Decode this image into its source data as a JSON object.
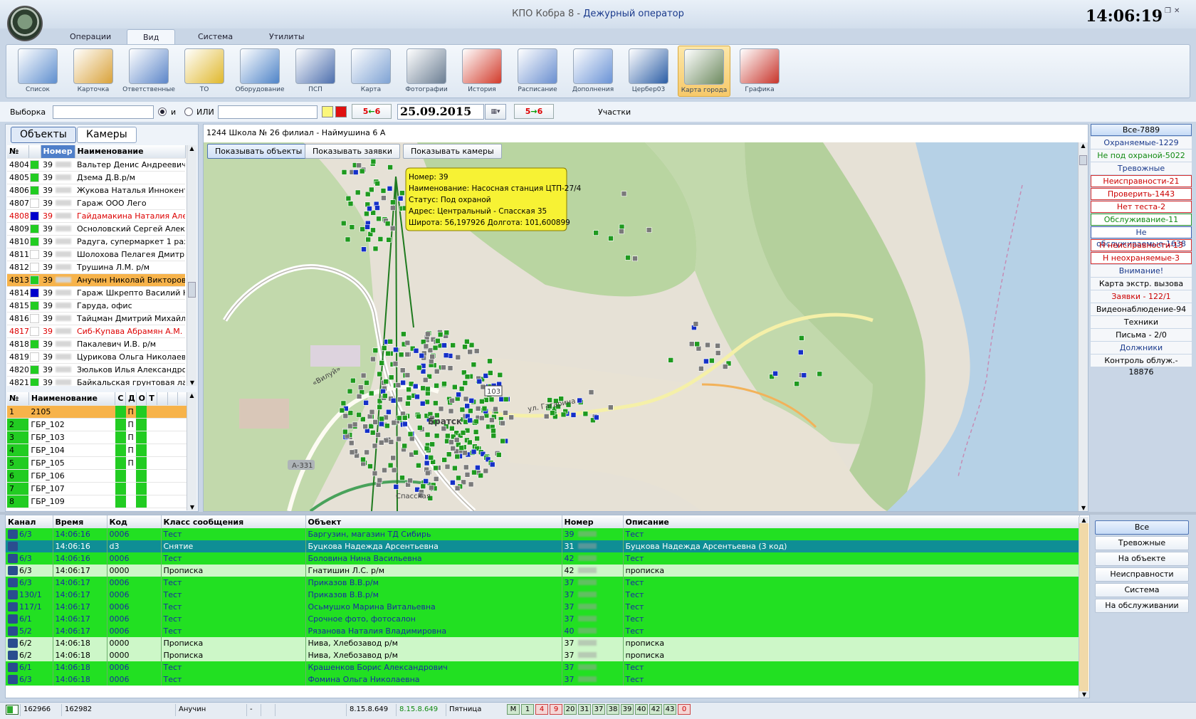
{
  "window": {
    "app_title": "КПО Кобра 8 - ",
    "role": "Дежурный оператор",
    "clock": "14:06:19"
  },
  "tabs": [
    "Операции",
    "Вид",
    "Система",
    "Утилиты"
  ],
  "ribbon": [
    {
      "label": "Список",
      "icon": "list-icon"
    },
    {
      "label": "Карточка",
      "icon": "card-icon"
    },
    {
      "label": "Ответственные",
      "icon": "users-icon"
    },
    {
      "label": "ТО",
      "icon": "maintenance-icon"
    },
    {
      "label": "Оборудование",
      "icon": "equipment-icon"
    },
    {
      "label": "ПСП",
      "icon": "psp-icon"
    },
    {
      "label": "Карта",
      "icon": "map-icon"
    },
    {
      "label": "Фотографии",
      "icon": "camera-icon"
    },
    {
      "label": "История",
      "icon": "history-icon"
    },
    {
      "label": "Расписание",
      "icon": "schedule-icon"
    },
    {
      "label": "Дополнения",
      "icon": "addons-icon"
    },
    {
      "label": "Цербер03",
      "icon": "cerber-icon"
    },
    {
      "label": "Карта города",
      "icon": "city-map-icon"
    },
    {
      "label": "Графика",
      "icon": "graphics-icon"
    }
  ],
  "filter": {
    "label": "Выборка",
    "and_label": "и",
    "or_label": "ИЛИ",
    "count_a": "5",
    "count_b": "6",
    "date": "25.09.2015",
    "areas_label": "Участки"
  },
  "left_tabs": {
    "objects": "Объекты",
    "cameras": "Камеры"
  },
  "objects_table": {
    "headers": [
      "№",
      "",
      "Номер",
      "Наименование"
    ],
    "rows": [
      {
        "n": "4804",
        "color": "#22cc22",
        "num": "39",
        "name": "Вальтер Денис Андреевич",
        "red": false,
        "sel": false
      },
      {
        "n": "4805",
        "color": "#22cc22",
        "num": "39",
        "name": "Дзема Д.В.р/м",
        "red": false,
        "sel": false
      },
      {
        "n": "4806",
        "color": "#22cc22",
        "num": "39",
        "name": "Жукова Наталья Иннокенть",
        "red": false,
        "sel": false
      },
      {
        "n": "4807",
        "color": "#ffffff",
        "num": "39",
        "name": "Гараж ООО Лего",
        "red": false,
        "sel": false
      },
      {
        "n": "4808",
        "color": "#0000cc",
        "num": "39",
        "name": "Гайдамакина Наталия Алек",
        "red": true,
        "sel": false
      },
      {
        "n": "4809",
        "color": "#22cc22",
        "num": "39",
        "name": "Осноловский Сергей Алекса",
        "red": false,
        "sel": false
      },
      {
        "n": "4810",
        "color": "#22cc22",
        "num": "39",
        "name": "Радуга, супермаркет 1 разд",
        "red": false,
        "sel": false
      },
      {
        "n": "4811",
        "color": "#ffffff",
        "num": "39",
        "name": "Шолохова Пелагея Дмитрие",
        "red": false,
        "sel": false
      },
      {
        "n": "4812",
        "color": "#ffffff",
        "num": "39",
        "name": "Трушина Л.М. р/м",
        "red": false,
        "sel": false
      },
      {
        "n": "4813",
        "color": "#22cc22",
        "num": "39",
        "name": "Анучин Николай Викторови",
        "red": false,
        "sel": true
      },
      {
        "n": "4814",
        "color": "#0000cc",
        "num": "39",
        "name": "Гараж Шкрепто Василий Ни",
        "red": false,
        "sel": false
      },
      {
        "n": "4815",
        "color": "#22cc22",
        "num": "39",
        "name": "Гаруда, офис",
        "red": false,
        "sel": false
      },
      {
        "n": "4816",
        "color": "#ffffff",
        "num": "39",
        "name": "Тайцман Дмитрий Михайлов",
        "red": false,
        "sel": false
      },
      {
        "n": "4817",
        "color": "#ffffff",
        "num": "39",
        "name": "Сиб-Купава Абрамян А.М. р",
        "red": true,
        "sel": false
      },
      {
        "n": "4818",
        "color": "#22cc22",
        "num": "39",
        "name": "Пакалевич И.В. р/м",
        "red": false,
        "sel": false
      },
      {
        "n": "4819",
        "color": "#ffffff",
        "num": "39",
        "name": "Цурикова Ольга Николаевн",
        "red": false,
        "sel": false
      },
      {
        "n": "4820",
        "color": "#22cc22",
        "num": "39",
        "name": "Зюльков Илья Александров",
        "red": false,
        "sel": false
      },
      {
        "n": "4821",
        "color": "#22cc22",
        "num": "39",
        "name": "Байкальская грунтовая лаб",
        "red": false,
        "sel": false
      }
    ]
  },
  "groups_table": {
    "headers": [
      "№",
      "Наименование",
      "С",
      "Д",
      "О",
      "Т"
    ],
    "rows": [
      {
        "n": "1",
        "name": "2105",
        "d": "П",
        "sel": true
      },
      {
        "n": "2",
        "name": "ГБР_102",
        "d": "П",
        "sel": false
      },
      {
        "n": "3",
        "name": "ГБР_103",
        "d": "П",
        "sel": false
      },
      {
        "n": "4",
        "name": "ГБР_104",
        "d": "П",
        "sel": false
      },
      {
        "n": "5",
        "name": "ГБР_105",
        "d": "П",
        "sel": false
      },
      {
        "n": "6",
        "name": "ГБР_106",
        "d": "",
        "sel": false
      },
      {
        "n": "7",
        "name": "ГБР_107",
        "d": "",
        "sel": false
      },
      {
        "n": "8",
        "name": "ГБР_109",
        "d": "",
        "sel": false
      }
    ]
  },
  "map": {
    "header": "1244 Школа № 26 филиал - Наймушина 6 А",
    "buttons": [
      "Показывать объекты",
      "Показывать заявки",
      "Показывать камеры"
    ],
    "tooltip": [
      "Номер: 39",
      "Наименование: Насосная станция ЦТП-27/4",
      "Статус: Под охраной",
      "Адрес: Центральный - Спасская 35",
      "Широта: 56,197926 Долгота: 101,600899"
    ],
    "labels": [
      "«Вилуй»",
      "А-331",
      "103",
      "ул. Гагарина",
      "Братск",
      "Спасская"
    ]
  },
  "categories": [
    {
      "label": "Все-7889",
      "color": "#000000",
      "style": "sel"
    },
    {
      "label": "Охраняемые-1229",
      "color": "#1a3a8c",
      "style": ""
    },
    {
      "label": "Не под охраной-5022",
      "color": "#118a11",
      "style": ""
    },
    {
      "label": "Тревожные",
      "color": "#1a3a8c",
      "style": ""
    },
    {
      "label": "Неисправности-21",
      "color": "#cc0000",
      "style": "red"
    },
    {
      "label": "Проверить-1443",
      "color": "#cc0000",
      "style": "red"
    },
    {
      "label": "Нет теста-2",
      "color": "#cc0000",
      "style": "red"
    },
    {
      "label": "Обслуживание-11",
      "color": "#118a11",
      "style": "green"
    },
    {
      "label": "Не обслуживаемые-1638",
      "color": "#1a3a8c",
      "style": "blue"
    },
    {
      "label": "Н неисправности-13",
      "color": "#cc0000",
      "style": "red"
    },
    {
      "label": "Н неохраняемые-3",
      "color": "#cc0000",
      "style": "red"
    },
    {
      "label": "Внимание!",
      "color": "#1a3a8c",
      "style": ""
    },
    {
      "label": "Карта экстр. вызова",
      "color": "#000000",
      "style": ""
    },
    {
      "label": "Заявки - 122/1",
      "color": "#cc0000",
      "style": ""
    },
    {
      "label": "Видеонаблюдение-94",
      "color": "#000000",
      "style": ""
    },
    {
      "label": "Техники",
      "color": "#000000",
      "style": ""
    },
    {
      "label": "Письма - 2/0",
      "color": "#000000",
      "style": ""
    },
    {
      "label": "Должники",
      "color": "#1a3a8c",
      "style": ""
    },
    {
      "label": "Контроль облуж.- 18876",
      "color": "#000000",
      "style": ""
    }
  ],
  "events": {
    "headers": [
      "Канал",
      "Время",
      "Код",
      "Класс сообщения",
      "Объект",
      "Номер",
      "Описание"
    ],
    "rows": [
      {
        "ch": "6/3",
        "time": "14:06:16",
        "code": "0006",
        "cls": "Тест",
        "obj": "Баргузин, магазин ТД Сибирь",
        "num": "39",
        "desc": "Тест",
        "style": "b",
        "chip": "C"
      },
      {
        "ch": "",
        "time": "14:06:16",
        "code": "d3",
        "cls": "Снятие",
        "obj": "Буцкова Надежда Арсентьевна",
        "num": "31",
        "desc": "Буцкова Надежда Арсентьевна (3 код)",
        "style": "t",
        "chip": "R"
      },
      {
        "ch": "6/3",
        "time": "14:06:16",
        "code": "0006",
        "cls": "Тест",
        "obj": "Боловина Нина Васильевна",
        "num": "42",
        "desc": "Тест",
        "style": "b",
        "chip": "C"
      },
      {
        "ch": "6/3",
        "time": "14:06:17",
        "code": "0000",
        "cls": "Прописка",
        "obj": "Гнатишин Л.С. р/м",
        "num": "42",
        "desc": "прописка",
        "style": "l",
        "chip": "C"
      },
      {
        "ch": "6/3",
        "time": "14:06:17",
        "code": "0006",
        "cls": "Тест",
        "obj": "Приказов В.В.р/м",
        "num": "37",
        "desc": "Тест",
        "style": "b",
        "chip": "C"
      },
      {
        "ch": "130/1",
        "time": "14:06:17",
        "code": "0006",
        "cls": "Тест",
        "obj": "Приказов В.В.р/м",
        "num": "37",
        "desc": "Тест",
        "style": "b",
        "chip": "C"
      },
      {
        "ch": "117/1",
        "time": "14:06:17",
        "code": "0006",
        "cls": "Тест",
        "obj": "Осьмушко Марина Витальевна",
        "num": "37",
        "desc": "Тест",
        "style": "b",
        "chip": "C"
      },
      {
        "ch": "6/1",
        "time": "14:06:17",
        "code": "0006",
        "cls": "Тест",
        "obj": "Срочное фото, фотосалон",
        "num": "37",
        "desc": "Тест",
        "style": "b",
        "chip": "C"
      },
      {
        "ch": "5/2",
        "time": "14:06:17",
        "code": "0006",
        "cls": "Тест",
        "obj": "Рязанова Наталия Владимировна",
        "num": "40",
        "desc": "Тест",
        "style": "b",
        "chip": "C"
      },
      {
        "ch": "6/2",
        "time": "14:06:18",
        "code": "0000",
        "cls": "Прописка",
        "obj": "Нива, Хлебозавод р/м",
        "num": "37",
        "desc": "прописка",
        "style": "l",
        "chip": "C"
      },
      {
        "ch": "6/2",
        "time": "14:06:18",
        "code": "0000",
        "cls": "Прописка",
        "obj": "Нива, Хлебозавод р/м",
        "num": "37",
        "desc": "прописка",
        "style": "l",
        "chip": "C"
      },
      {
        "ch": "6/1",
        "time": "14:06:18",
        "code": "0006",
        "cls": "Тест",
        "obj": "Крашенков Борис Александрович",
        "num": "37",
        "desc": "Тест",
        "style": "b",
        "chip": "C"
      },
      {
        "ch": "6/3",
        "time": "14:06:18",
        "code": "0006",
        "cls": "Тест",
        "obj": "Фомина Ольга Николаевна",
        "num": "37",
        "desc": "Тест",
        "style": "b",
        "chip": "C"
      }
    ]
  },
  "event_filters": [
    "Все",
    "Тревожные",
    "На объекте",
    "Неисправности",
    "Система",
    "На обслуживании"
  ],
  "status": {
    "a": "162966",
    "b": "162982",
    "user": "Анучин",
    "dash": "-",
    "ver1": "8.15.8.649",
    "ver2": "8.15.8.649",
    "day": "Пятница",
    "badges": [
      {
        "t": "M",
        "red": false
      },
      {
        "t": "1",
        "red": false
      },
      {
        "t": "4",
        "red": true
      },
      {
        "t": "9",
        "red": true
      },
      {
        "t": "20",
        "red": false
      },
      {
        "t": "31",
        "red": false
      },
      {
        "t": "37",
        "red": false
      },
      {
        "t": "38",
        "red": false
      },
      {
        "t": "39",
        "red": false
      },
      {
        "t": "40",
        "red": false
      },
      {
        "t": "42",
        "red": false
      },
      {
        "t": "43",
        "red": false
      },
      {
        "t": "0",
        "red": true
      }
    ]
  },
  "colors": {
    "green": "#22e022",
    "light_green": "#cdf7c8",
    "teal": "#0f8e95",
    "selected_row": "#f7b34a",
    "tooltip": "#f7f234"
  }
}
